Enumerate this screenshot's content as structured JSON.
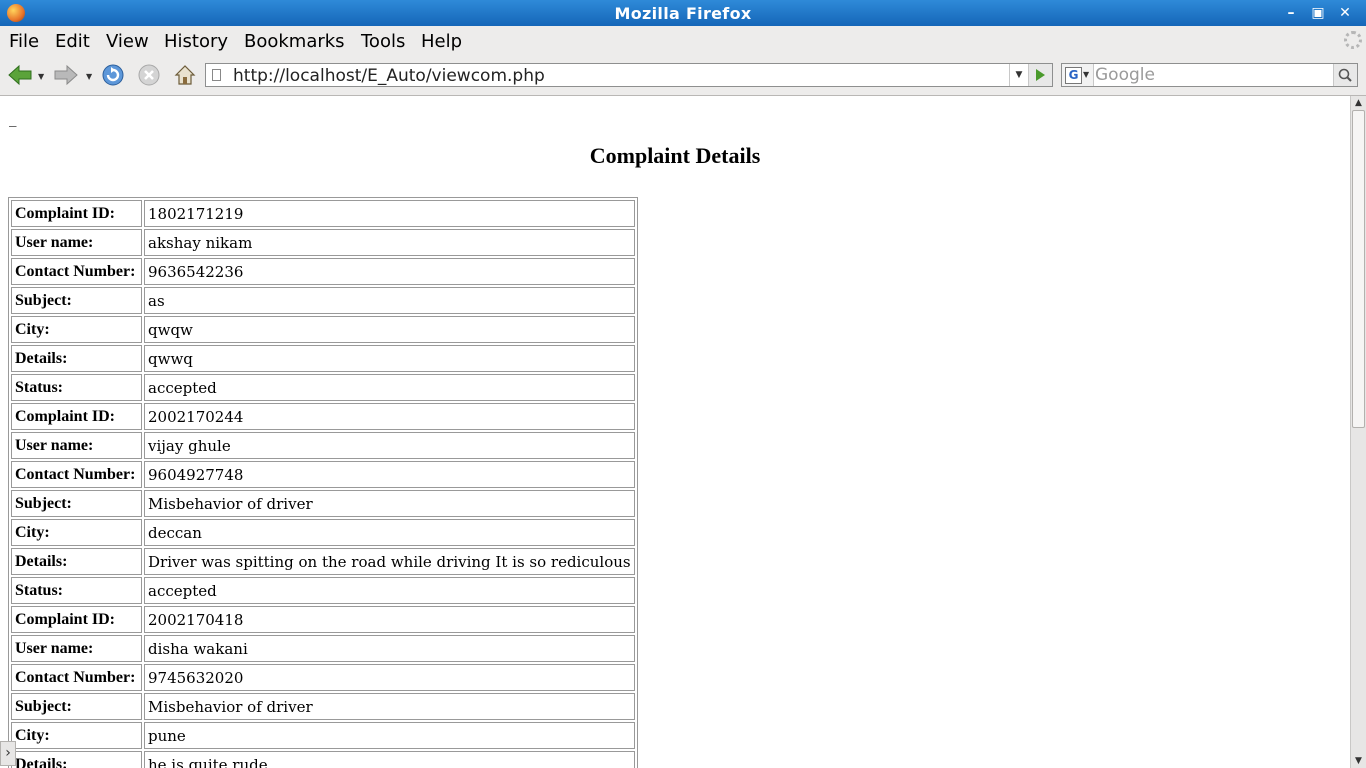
{
  "window": {
    "title": "Mozilla Firefox",
    "controls": {
      "minimize": "minimize-icon",
      "maximize": "maximize-icon",
      "close": "close-icon"
    }
  },
  "menu": {
    "items": [
      "File",
      "Edit",
      "View",
      "History",
      "Bookmarks",
      "Tools",
      "Help"
    ]
  },
  "toolbar": {
    "url": "http://localhost/E_Auto/viewcom.php",
    "search_placeholder": "Google",
    "search_engine_letter": "G"
  },
  "page": {
    "dash": "_",
    "heading": "Complaint Details",
    "rows": [
      {
        "label": "Complaint ID:",
        "value": "1802171219"
      },
      {
        "label": "User name:",
        "value": "akshay nikam"
      },
      {
        "label": "Contact Number:",
        "value": "9636542236"
      },
      {
        "label": "Subject:",
        "value": "as"
      },
      {
        "label": "City:",
        "value": "qwqw"
      },
      {
        "label": "Details:",
        "value": "qwwq"
      },
      {
        "label": "Status:",
        "value": "accepted"
      },
      {
        "label": "Complaint ID:",
        "value": "2002170244"
      },
      {
        "label": "User name:",
        "value": "vijay ghule"
      },
      {
        "label": "Contact Number:",
        "value": "9604927748"
      },
      {
        "label": "Subject:",
        "value": "Misbehavior of driver"
      },
      {
        "label": "City:",
        "value": "deccan"
      },
      {
        "label": "Details:",
        "value": "Driver was spitting on the road while driving It is so rediculous"
      },
      {
        "label": "Status:",
        "value": "accepted"
      },
      {
        "label": "Complaint ID:",
        "value": "2002170418"
      },
      {
        "label": "User name:",
        "value": "disha wakani"
      },
      {
        "label": "Contact Number:",
        "value": "9745632020"
      },
      {
        "label": "Subject:",
        "value": "Misbehavior of driver"
      },
      {
        "label": "City:",
        "value": "pune"
      },
      {
        "label": "Details:",
        "value": "he is quite rude"
      }
    ]
  }
}
